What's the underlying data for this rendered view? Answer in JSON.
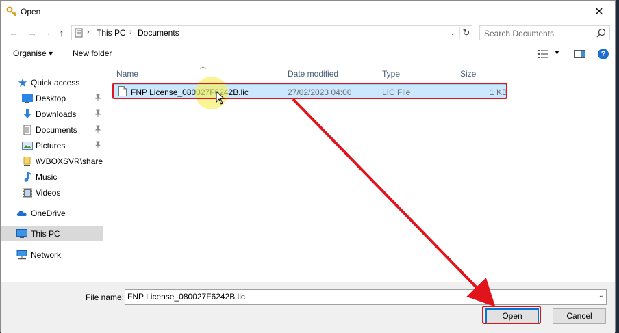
{
  "window": {
    "title": "Open",
    "close_glyph": "✕"
  },
  "address": {
    "breadcrumbs": [
      "This PC",
      "Documents"
    ],
    "search_placeholder": "Search Documents"
  },
  "toolbar": {
    "organise_label": "Organise ▾",
    "new_folder_label": "New folder",
    "help_glyph": "?"
  },
  "sidebar": {
    "items": [
      {
        "label": "Quick access",
        "icon": "star-icon"
      },
      {
        "label": "Desktop",
        "icon": "desktop-icon",
        "pinned": true
      },
      {
        "label": "Downloads",
        "icon": "download-icon",
        "pinned": true
      },
      {
        "label": "Documents",
        "icon": "document-icon",
        "pinned": true
      },
      {
        "label": "Pictures",
        "icon": "pictures-icon",
        "pinned": true
      },
      {
        "label": "\\\\VBOXSVR\\shared_",
        "icon": "network-folder-icon"
      },
      {
        "label": "Music",
        "icon": "music-icon"
      },
      {
        "label": "Videos",
        "icon": "video-icon"
      },
      {
        "label": "OneDrive",
        "icon": "cloud-icon"
      },
      {
        "label": "This PC",
        "icon": "computer-icon",
        "selected": true
      },
      {
        "label": "Network",
        "icon": "network-icon"
      }
    ]
  },
  "columns": {
    "name": "Name",
    "date": "Date modified",
    "type": "Type",
    "size": "Size"
  },
  "files": [
    {
      "name": "FNP License_080027F6242B.lic",
      "date": "27/02/2023 04:00",
      "type": "LIC File",
      "size": "1 KB"
    }
  ],
  "bottom": {
    "file_name_label": "File name:",
    "file_name_value": "FNP License_080027F6242B.lic",
    "open_label": "Open",
    "cancel_label": "Cancel"
  },
  "colors": {
    "annotation_red": "#e0141a",
    "selection_blue": "#cce8ff",
    "accent": "#0078d7"
  }
}
